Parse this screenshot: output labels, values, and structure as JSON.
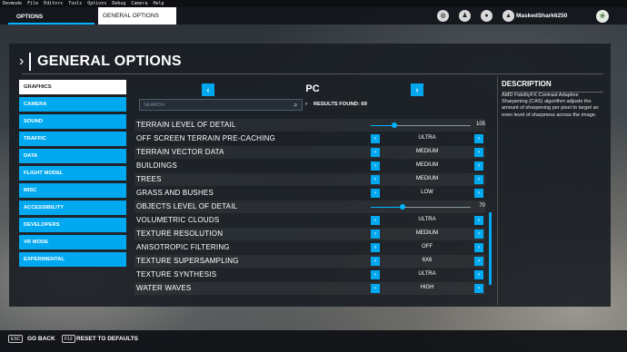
{
  "devmenu": [
    "Devmode",
    "File",
    "Editors",
    "Tools",
    "Options",
    "Debug",
    "Camera",
    "Help"
  ],
  "topbar": {
    "tab_active": "OPTIONS",
    "tab_open": "GENERAL OPTIONS",
    "username": "MaskedShark6250"
  },
  "header": {
    "title": "GENERAL OPTIONS"
  },
  "menu": [
    "GRAPHICS",
    "CAMERA",
    "SOUND",
    "TRAFFIC",
    "DATA",
    "FLIGHT MODEL",
    "MISC",
    "ACCESSIBILITY",
    "DEVELOPERS",
    "VR MODE",
    "EXPERIMENTAL"
  ],
  "menu_active_index": 0,
  "preset": {
    "label": "PC",
    "prev": "‹",
    "next": "›"
  },
  "search": {
    "placeholder": "SEARCH",
    "results_label": "RESULTS FOUND: 69"
  },
  "settings": [
    {
      "label": "TERRAIN LEVEL OF DETAIL",
      "type": "slider",
      "value": "105",
      "fraction": 0.24
    },
    {
      "label": "OFF SCREEN TERRAIN PRE-CACHING",
      "type": "select",
      "value": "ULTRA"
    },
    {
      "label": "TERRAIN VECTOR DATA",
      "type": "select",
      "value": "MEDIUM"
    },
    {
      "label": "BUILDINGS",
      "type": "select",
      "value": "MEDIUM"
    },
    {
      "label": "TREES",
      "type": "select",
      "value": "MEDIUM"
    },
    {
      "label": "GRASS AND BUSHES",
      "type": "select",
      "value": "LOW"
    },
    {
      "label": "OBJECTS LEVEL OF DETAIL",
      "type": "slider",
      "value": "70",
      "fraction": 0.32
    },
    {
      "label": "VOLUMETRIC CLOUDS",
      "type": "select",
      "value": "ULTRA"
    },
    {
      "label": "TEXTURE RESOLUTION",
      "type": "select",
      "value": "MEDIUM"
    },
    {
      "label": "ANISOTROPIC FILTERING",
      "type": "select",
      "value": "OFF"
    },
    {
      "label": "TEXTURE SUPERSAMPLING",
      "type": "select",
      "value": "6X6"
    },
    {
      "label": "TEXTURE SYNTHESIS",
      "type": "select",
      "value": "ULTRA"
    },
    {
      "label": "WATER WAVES",
      "type": "select",
      "value": "HIGH"
    }
  ],
  "description": {
    "title": "DESCRIPTION",
    "text": "AMD FidelityFX Contrast Adaptive Sharpening (CAS) algorithm adjusts the amount of sharpening per pixel to target an even level of sharpness across the image."
  },
  "bottom": {
    "back_key": "ESC",
    "back_label": "GO BACK",
    "reset_key": "F12",
    "reset_label": "RESET TO DEFAULTS"
  },
  "colors": {
    "accent": "#00a8f0",
    "panel": "#1a1e24"
  }
}
